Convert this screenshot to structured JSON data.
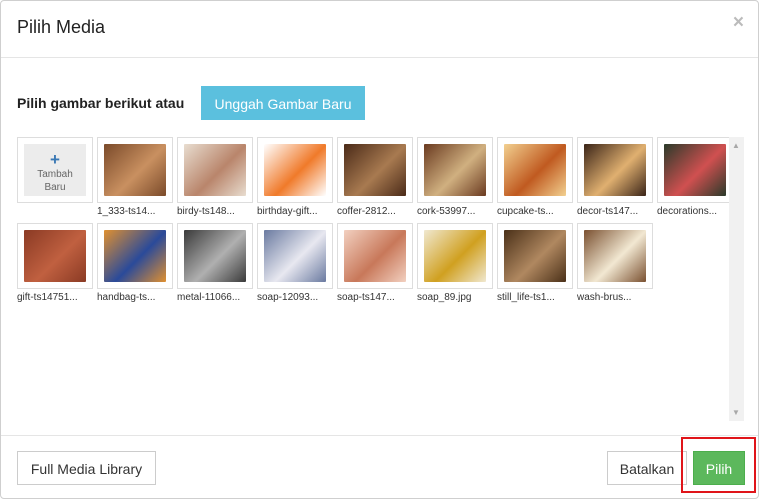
{
  "dialog": {
    "title": "Pilih Media",
    "close_label": "×",
    "prompt": "Pilih gambar berikut atau",
    "upload_label": "Unggah Gambar Baru"
  },
  "add_tile": {
    "plus": "+",
    "label_1": "Tambah",
    "label_2": "Baru"
  },
  "media": [
    {
      "caption": "1_333-ts14...",
      "colors": [
        "#7a4a2a",
        "#c99060"
      ]
    },
    {
      "caption": "birdy-ts148...",
      "colors": [
        "#e8ddd0",
        "#b9856b"
      ]
    },
    {
      "caption": "birthday-gift...",
      "colors": [
        "#ffffff",
        "#f07a2a"
      ]
    },
    {
      "caption": "coffer-2812...",
      "colors": [
        "#4a2a18",
        "#a87a50"
      ]
    },
    {
      "caption": "cork-53997...",
      "colors": [
        "#6a3a20",
        "#d0b080"
      ]
    },
    {
      "caption": "cupcake-ts...",
      "colors": [
        "#f2d090",
        "#c05a20"
      ]
    },
    {
      "caption": "decor-ts147...",
      "colors": [
        "#3a2418",
        "#e0b070"
      ]
    },
    {
      "caption": "decorations...",
      "colors": [
        "#2a3a2a",
        "#d05050"
      ]
    },
    {
      "caption": "gift-ts14751...",
      "colors": [
        "#8a3a24",
        "#c06040"
      ]
    },
    {
      "caption": "handbag-ts...",
      "colors": [
        "#e09030",
        "#2a4a9a"
      ]
    },
    {
      "caption": "metal-11066...",
      "colors": [
        "#3a3a3a",
        "#b0b0b0"
      ]
    },
    {
      "caption": "soap-12093...",
      "colors": [
        "#6a7aa0",
        "#e8e8f0"
      ]
    },
    {
      "caption": "soap-ts147...",
      "colors": [
        "#f2d0c0",
        "#c8785a"
      ]
    },
    {
      "caption": "soap_89.jpg",
      "colors": [
        "#f0e8d0",
        "#d0a020"
      ]
    },
    {
      "caption": "still_life-ts1...",
      "colors": [
        "#4a3018",
        "#b08860"
      ]
    },
    {
      "caption": "wash-brus...",
      "colors": [
        "#7a5030",
        "#f2e8d2"
      ]
    }
  ],
  "footer": {
    "library_label": "Full Media Library",
    "cancel_label": "Batalkan",
    "select_label": "Pilih"
  },
  "scrollbar": {
    "up": "▲",
    "down": "▼"
  },
  "colors": {
    "upload": "#5bc0de",
    "select": "#5cb85c",
    "highlight": "#e0151a"
  }
}
